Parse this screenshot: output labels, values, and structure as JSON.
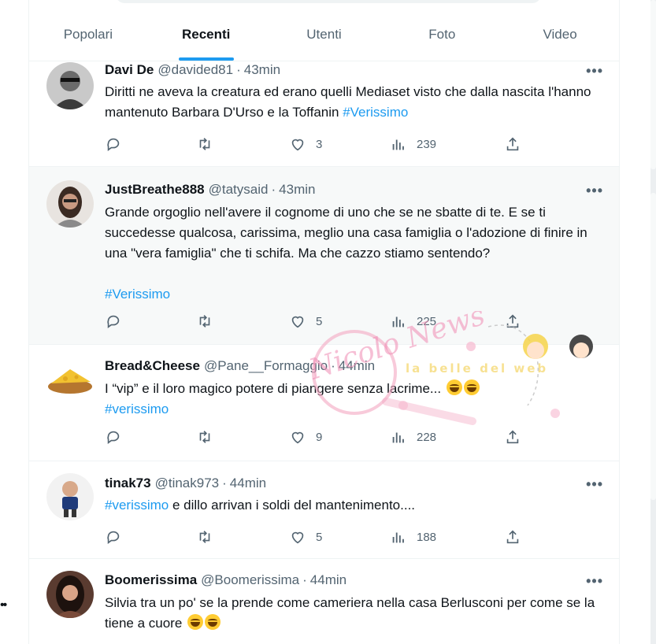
{
  "tabs": [
    {
      "label": "Popolari",
      "active": false
    },
    {
      "label": "Recenti",
      "active": true
    },
    {
      "label": "Utenti",
      "active": false
    },
    {
      "label": "Foto",
      "active": false
    },
    {
      "label": "Video",
      "active": false
    }
  ],
  "tweets": [
    {
      "name": "Davi De",
      "handle": "@davided81",
      "time": "43min",
      "text": "Diritti ne aveva la creatura ed erano quelli Mediaset visto che dalla nascita l'hanno mantenuto Barbara D'Urso e la Toffanin ",
      "hashtag": "#Verissimo",
      "likes": "3",
      "views": "239",
      "retweets": "",
      "replies": ""
    },
    {
      "name": "JustBreathe888",
      "handle": "@tatysaid",
      "time": "43min",
      "text": "Grande orgoglio nell'avere il cognome di uno che se ne sbatte di te. E se ti succedesse qualcosa, carissima, meglio una casa famiglia o l'adozione di finire in una \"vera famiglia\" che ti schifa. Ma che cazzo stiamo sentendo?",
      "hashtag": "#Verissimo",
      "likes": "5",
      "views": "225",
      "retweets": "",
      "replies": ""
    },
    {
      "name": "Bread&Cheese",
      "handle": "@Pane__Formaggio",
      "time": "44min",
      "text": "I “vip” e il loro magico potere di piangere senza lacrime... ",
      "hashtag": "#verissimo",
      "likes": "9",
      "views": "228",
      "retweets": "",
      "replies": ""
    },
    {
      "name": "tinak73",
      "handle": "@tinak973",
      "time": "44min",
      "hashtag": "#verissimo",
      "text": " e dillo arrivan i soldi del mantenimento....",
      "likes": "5",
      "views": "188",
      "retweets": "",
      "replies": ""
    },
    {
      "name": "Boomerissima",
      "handle": "@Boomerissima",
      "time": "44min",
      "text": "Silvia tra un po' se la prende come cameriera nella casa Berlusconi per come se la tiene a cuore ",
      "likes": "",
      "views": ""
    }
  ],
  "separator": "·",
  "more_glyph": "•••",
  "watermark": {
    "script": "Nicolo News",
    "banner": "la belle del web"
  },
  "icons": {
    "reply": "reply-icon",
    "retweet": "retweet-icon",
    "like": "heart-icon",
    "views": "views-icon",
    "share": "share-icon"
  },
  "colors": {
    "accent": "#1d9bf0",
    "text": "#0f1419",
    "muted": "#536471",
    "highlight_bg": "#f7f9f9"
  }
}
